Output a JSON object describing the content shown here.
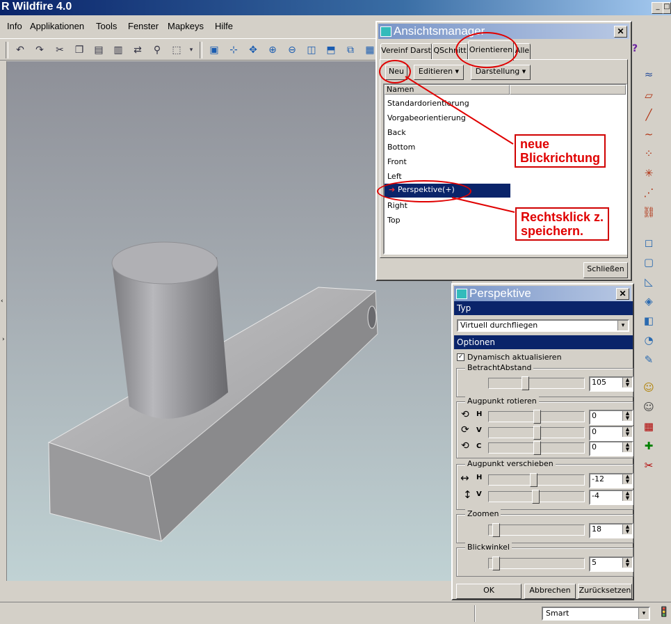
{
  "app": {
    "title": "R Wildfire 4.0"
  },
  "menu": [
    "Info",
    "Applikationen",
    "Tools",
    "Fenster",
    "Mapkeys",
    "Hilfe"
  ],
  "toolbar_icons": [
    "undo-icon",
    "redo-icon",
    "cut-icon",
    "copy-icon",
    "paste-icon",
    "paste-special-icon",
    "regenerate-icon",
    "find-icon",
    "select-box-icon",
    "repaint-icon",
    "spin-center-icon",
    "orient-icon",
    "zoom-in-icon",
    "zoom-out-icon",
    "refit-icon",
    "reorient-icon",
    "saved-views-icon"
  ],
  "view_manager": {
    "title": "Ansichtsmanager",
    "tabs": [
      "Vereinf Darst",
      "QSchnitt",
      "Orientieren",
      "Alle"
    ],
    "active_tab": "Orientieren",
    "buttons": {
      "new": "Neu",
      "edit": "Editieren ▾",
      "display": "Darstellung ▾"
    },
    "column_header": "Namen",
    "items": [
      "Standardorientierung",
      "Vorgabeorientierung",
      "Back",
      "Bottom",
      "Front",
      "Left",
      "Perspektive(+)",
      "Right",
      "Top"
    ],
    "selected_item": "Perspektive(+)",
    "close": "Schließen",
    "help_glyph": "?"
  },
  "perspective": {
    "title": "Perspektive",
    "type_section": "Typ",
    "type_value": "Virtuell durchfliegen",
    "options_section": "Optionen",
    "dynamic_update": "Dynamisch aktualisieren",
    "dynamic_update_checked": true,
    "view_distance": {
      "label": "BetrachtAbstand",
      "value": "105"
    },
    "rotate": {
      "label": "Augpunkt rotieren",
      "h": {
        "axis": "H",
        "value": "0"
      },
      "v": {
        "axis": "V",
        "value": "0"
      },
      "c": {
        "axis": "C",
        "value": "0"
      }
    },
    "move": {
      "label": "Augpunkt verschieben",
      "h": {
        "axis": "H",
        "value": "-12"
      },
      "v": {
        "axis": "V",
        "value": "-4"
      }
    },
    "zoom": {
      "label": "Zoomen",
      "value": "18"
    },
    "view_angle": {
      "label": "Blickwinkel",
      "value": "5"
    },
    "buttons": {
      "ok": "OK",
      "cancel": "Abbrechen",
      "reset": "Zurücksetzen"
    }
  },
  "annotations": {
    "new_direction": [
      "neue",
      "Blickrichtung"
    ],
    "right_click_save": [
      "Rechtsklick z.",
      "speichern."
    ]
  },
  "status": {
    "filter_value": "Smart"
  },
  "colors": {
    "accent_red": "#e00000",
    "selection_blue": "#0a246a"
  }
}
